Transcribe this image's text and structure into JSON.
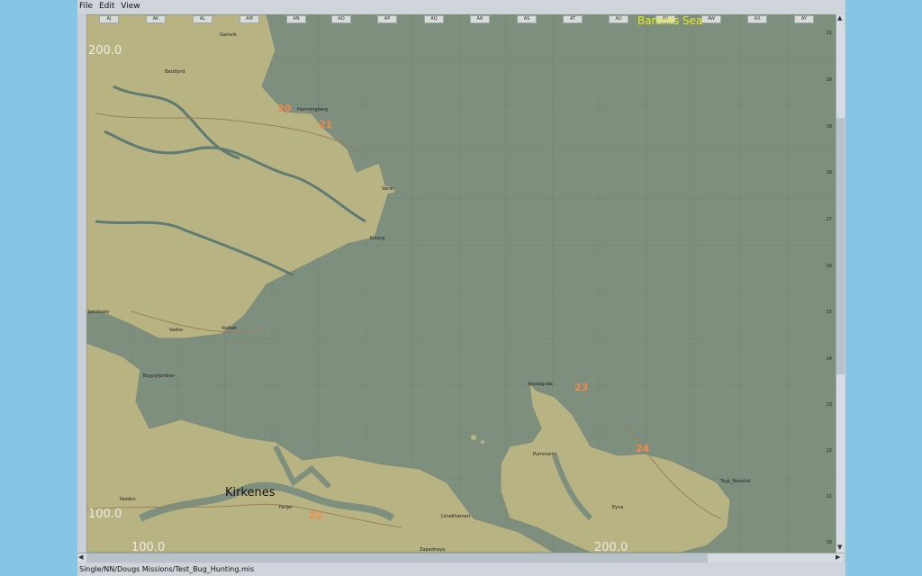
{
  "menu": {
    "items": [
      "File",
      "Edit",
      "View"
    ]
  },
  "map": {
    "columns": [
      "AJ",
      "AK",
      "AL",
      "AM",
      "AN",
      "AO",
      "AP",
      "AQ",
      "AR",
      "AS",
      "AT",
      "AU",
      "AV",
      "AW",
      "AX",
      "AY"
    ],
    "rows": [
      "21",
      "20",
      "19",
      "18",
      "17",
      "16",
      "15",
      "14",
      "13",
      "12",
      "11",
      "10"
    ],
    "sea_label": "Barents Sea",
    "coords": {
      "top_left": "200.0",
      "bottom_left": "100.0",
      "bottom_x_left": "100.0",
      "bottom_x_right": "200.0"
    },
    "town": "Kirkenes",
    "markers": [
      "20",
      "21",
      "23",
      "24",
      "22"
    ],
    "places": [
      "Gamvik",
      "Batsfjord",
      "Hamningberg",
      "Vardo",
      "Kiberg",
      "Jakobselv",
      "Vadso",
      "Vadset",
      "Bugoyfjordner",
      "Neiden",
      "Fanjel",
      "Liinakhamari",
      "Vaydaguba",
      "Pummanki",
      "Tsyp_Navolok",
      "Eyna",
      "Zapadnaya"
    ]
  },
  "status": {
    "path": "Single/NN/Dougs Missions/Test_Bug_Hunting.mis"
  },
  "colors": {
    "sea": "#7f8f7e",
    "land": "#b8b382",
    "marker": "#f28a4d",
    "sea_label": "#e6ee18"
  }
}
